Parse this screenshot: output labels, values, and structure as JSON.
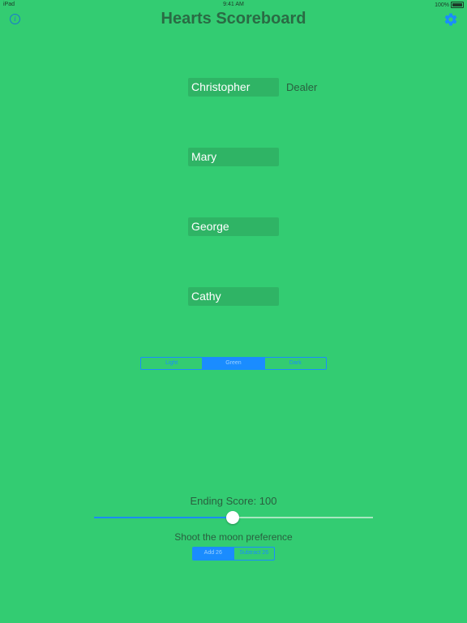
{
  "status_bar": {
    "device": "iPad",
    "time": "9:41 AM",
    "battery": "100%"
  },
  "header": {
    "title": "Hearts Scoreboard",
    "info_icon": "info-icon",
    "settings_icon": "gear-icon"
  },
  "players": [
    {
      "name": "Christopher",
      "dealer_label": "Dealer"
    },
    {
      "name": "Mary"
    },
    {
      "name": "George"
    },
    {
      "name": "Cathy"
    }
  ],
  "theme": {
    "options": [
      "Light",
      "Green",
      "Dark"
    ],
    "selected": "Green"
  },
  "ending_score": {
    "label": "Ending Score: 100",
    "value": 100
  },
  "slider": {
    "fraction": 0.5
  },
  "moon": {
    "label": "Shoot the moon preference",
    "options": [
      "Add 26",
      "Subtract 26"
    ],
    "selected": "Add 26"
  },
  "colors": {
    "background": "#33cc72",
    "accent": "#1a8cff",
    "field": "#2fb465"
  }
}
